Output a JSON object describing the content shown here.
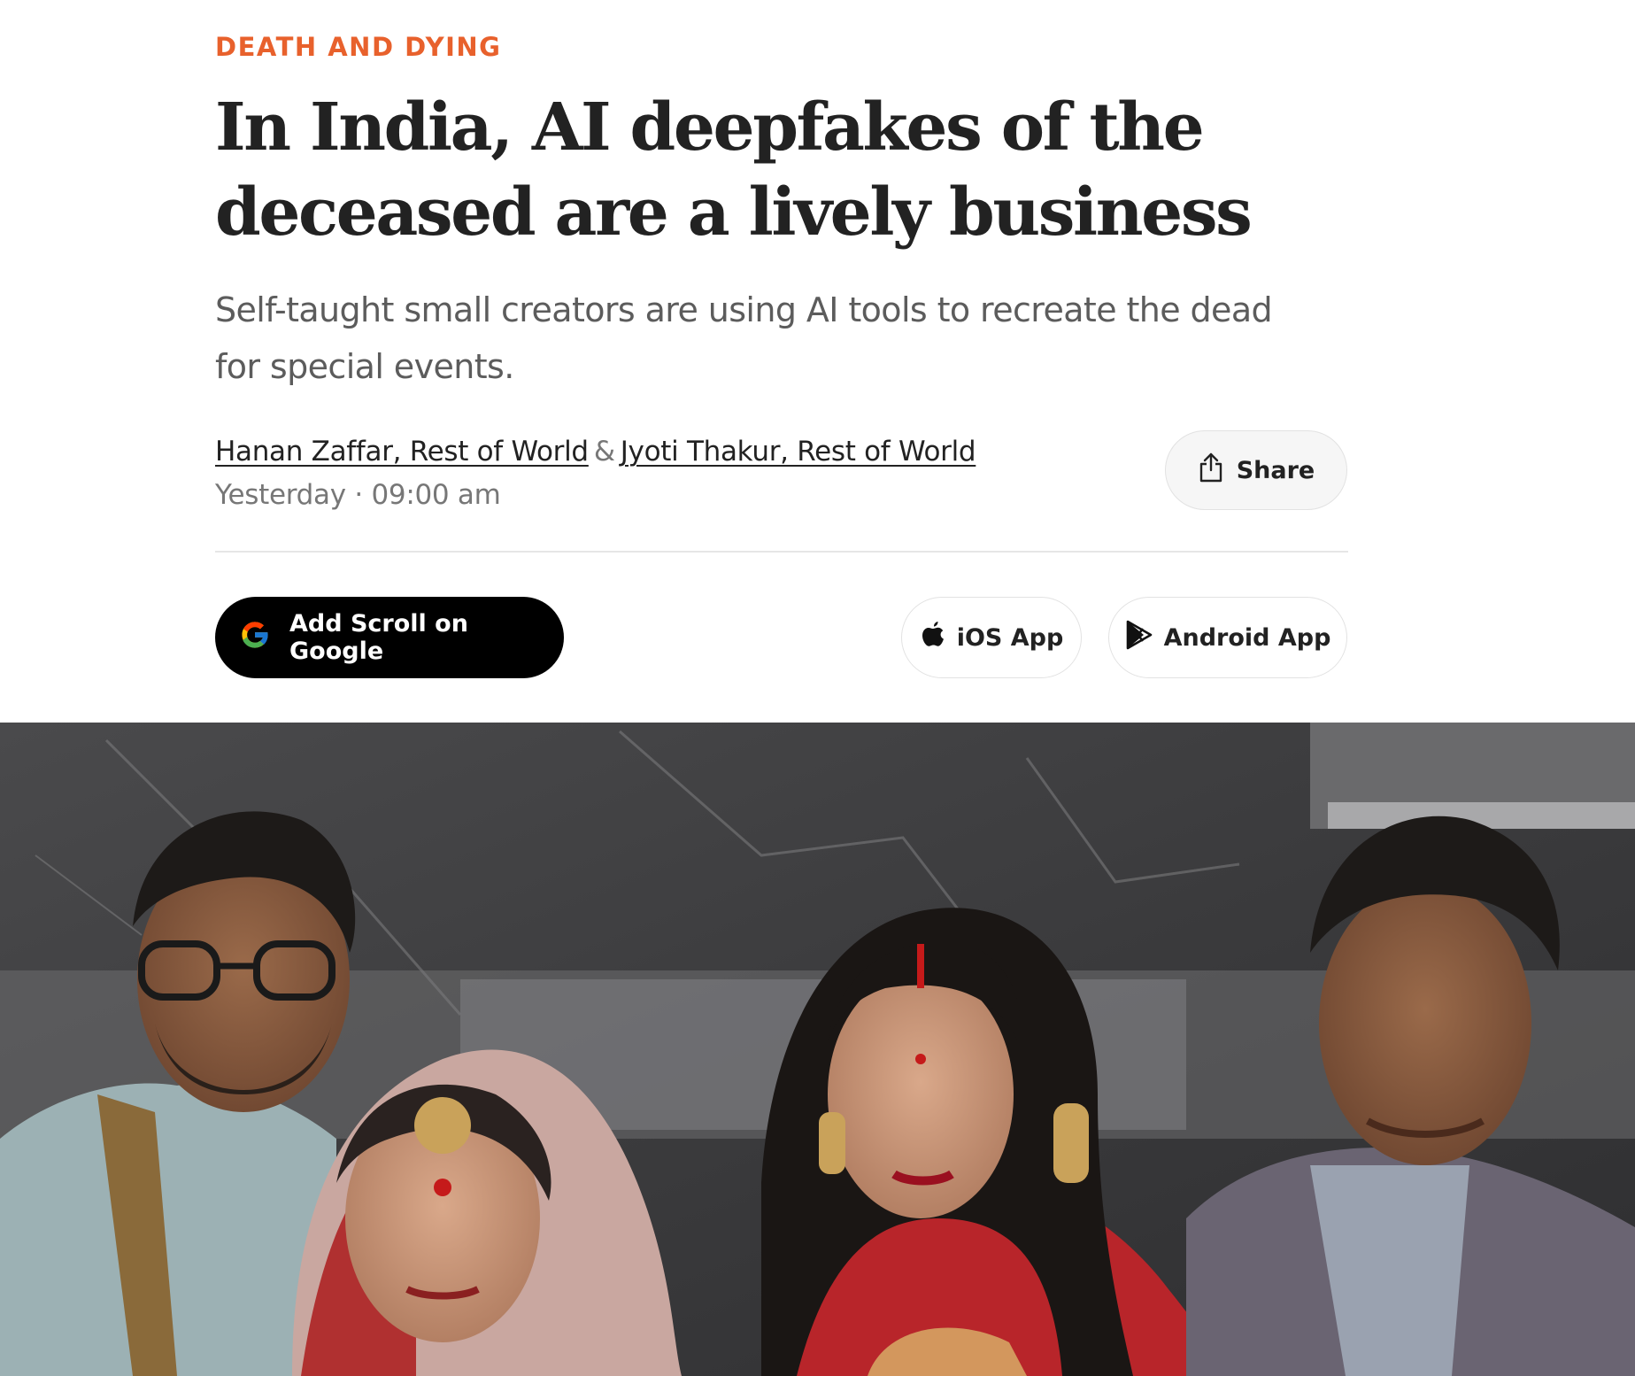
{
  "article": {
    "category": "DEATH AND DYING",
    "headline_lines": [
      "In India, AI deepfakes of the",
      "deceased are a lively business"
    ],
    "standfirst_lines": [
      "Self-taught small creators are using AI tools to recreate the dead",
      "for special events."
    ],
    "authors": [
      "Hanan Zaffar, Rest of World",
      "Jyoti Thakur, Rest of World"
    ],
    "author_separator": "&",
    "date": "Yesterday",
    "date_separator": "·",
    "time": "09:00 am"
  },
  "actions": {
    "share_label": "Share",
    "google_label": "Add Scroll on Google",
    "ios_label": "iOS App",
    "android_label": "Android App"
  },
  "icons": {
    "share": "share-icon",
    "google": "google-g-icon",
    "apple": "apple-icon",
    "android": "google-play-icon"
  },
  "colors": {
    "category": "#e8612c",
    "headline": "#222222",
    "standfirst": "#5c5c5c",
    "google_button_bg": "#000000"
  }
}
